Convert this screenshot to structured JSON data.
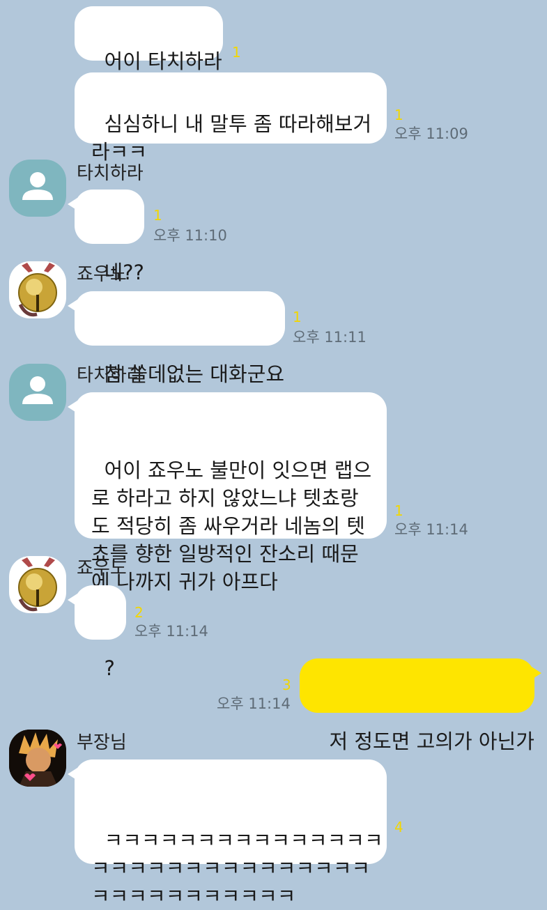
{
  "messages": [
    {
      "text": "어이 타치하라",
      "unread": "1"
    },
    {
      "text": "심심하니 내 말투 좀 따라해보거\n라ㅋㅋ",
      "unread": "1",
      "time": "오후 11:09"
    },
    {
      "sender": "타치하라",
      "avatar": "default-person-icon",
      "text": "네??",
      "unread": "1",
      "time": "오후 11:10"
    },
    {
      "sender": "죠우노",
      "avatar": "golden-bell-icon",
      "text": "참 쓸데없는 대화군요",
      "unread": "1",
      "time": "오후 11:11"
    },
    {
      "sender": "타치하라",
      "avatar": "default-person-icon",
      "text": "어이 죠우노 불만이 잇으면 랩으\n로 하라고 하지 않았느냐 텟쵸랑\n도 적당히 좀 싸우거라 네놈의 텟\n쵸를 향한 일방적인 잔소리 때문\n에 나까지 귀가 아프다",
      "unread": "1",
      "time": "오후 11:14"
    },
    {
      "sender": "죠우노",
      "avatar": "golden-bell-icon",
      "text": "?",
      "unread": "2",
      "time": "오후 11:14"
    },
    {
      "mine": true,
      "text": "저 정도면 고의가 아닌가",
      "unread": "3",
      "time": "오후 11:14"
    },
    {
      "sender": "부장님",
      "avatar": "anime-character-photo",
      "text": "ㅋㅋㅋㅋㅋㅋㅋㅋㅋㅋㅋㅋㅋㅋㅋ\nㅋㅋㅋㅋㅋㅋㅋㅋㅋㅋㅋㅋㅋㅋㅋ\nㅋㅋㅋㅋㅋㅋㅋㅋㅋㅋㅋ",
      "unread": "4"
    }
  ],
  "colors": {
    "background": "#b2c7da",
    "my_bubble": "#fee500",
    "other_bubble": "#ffffff",
    "unread": "#f2d600"
  }
}
